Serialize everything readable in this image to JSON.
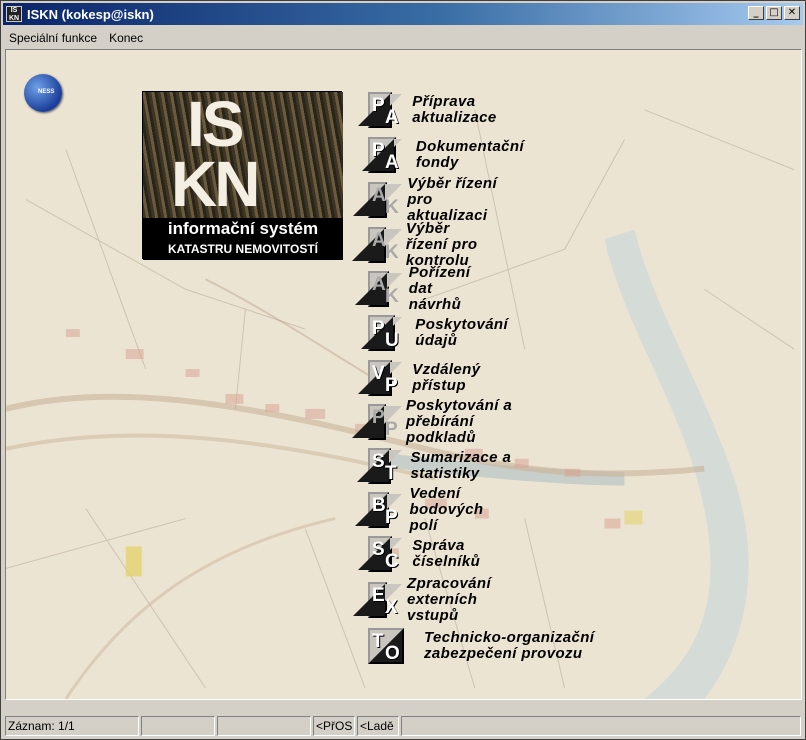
{
  "window": {
    "title": "ISKN (kokesp@iskn)",
    "icon_text": "IS KN",
    "buttons": {
      "minimize": "_",
      "maximize": "□",
      "close": "✕"
    }
  },
  "menubar": {
    "items": [
      {
        "label": "Speciální funkce"
      },
      {
        "label": "Konec"
      }
    ]
  },
  "logos": {
    "ness_text": "NESS",
    "iskn_line1": "IS",
    "iskn_line2": "KN",
    "iskn_band1": "informační systém",
    "iskn_band2": "KATASTRU NEMOVITOSTÍ"
  },
  "modules": [
    {
      "label": "Příprava aktualizace",
      "abbr1": "P",
      "abbr2": "A",
      "enabled": true
    },
    {
      "label": "Dokumentační fondy",
      "abbr1": "P",
      "abbr2": "A",
      "enabled": true
    },
    {
      "label": "Výběr řízení pro aktualizaci",
      "abbr1": "A",
      "abbr2": "K",
      "enabled": false
    },
    {
      "label": "Výběr řízení pro kontrolu",
      "abbr1": "A",
      "abbr2": "K",
      "enabled": false
    },
    {
      "label": "Pořízení dat návrhů",
      "abbr1": "A",
      "abbr2": "K",
      "enabled": false
    },
    {
      "label": "Poskytování údajů",
      "abbr1": "P",
      "abbr2": "U",
      "enabled": true
    },
    {
      "label": "Vzdálený přístup",
      "abbr1": "V",
      "abbr2": "P",
      "enabled": true
    },
    {
      "label": "Poskytování a přebírání podkladů",
      "abbr1": "P",
      "abbr2": "P",
      "enabled": false
    },
    {
      "label": "Sumarizace a statistiky",
      "abbr1": "S",
      "abbr2": "T",
      "enabled": true
    },
    {
      "label": "Vedení bodových polí",
      "abbr1": "B",
      "abbr2": "P",
      "enabled": true
    },
    {
      "label": "Správa číselníků",
      "abbr1": "S",
      "abbr2": "C",
      "enabled": true
    },
    {
      "label": "Zpracování externích vstupů",
      "abbr1": "E",
      "abbr2": "X",
      "enabled": true
    },
    {
      "label": "Technicko-organizační zabezpečení provozu",
      "abbr1": "T",
      "abbr2": "O",
      "enabled": true
    }
  ],
  "statusbar": {
    "record": "Záznam: 1/1",
    "cell2": "",
    "cell3": "",
    "pros": "<PřOS",
    "lade": "<Ladě",
    "cell6": ""
  }
}
